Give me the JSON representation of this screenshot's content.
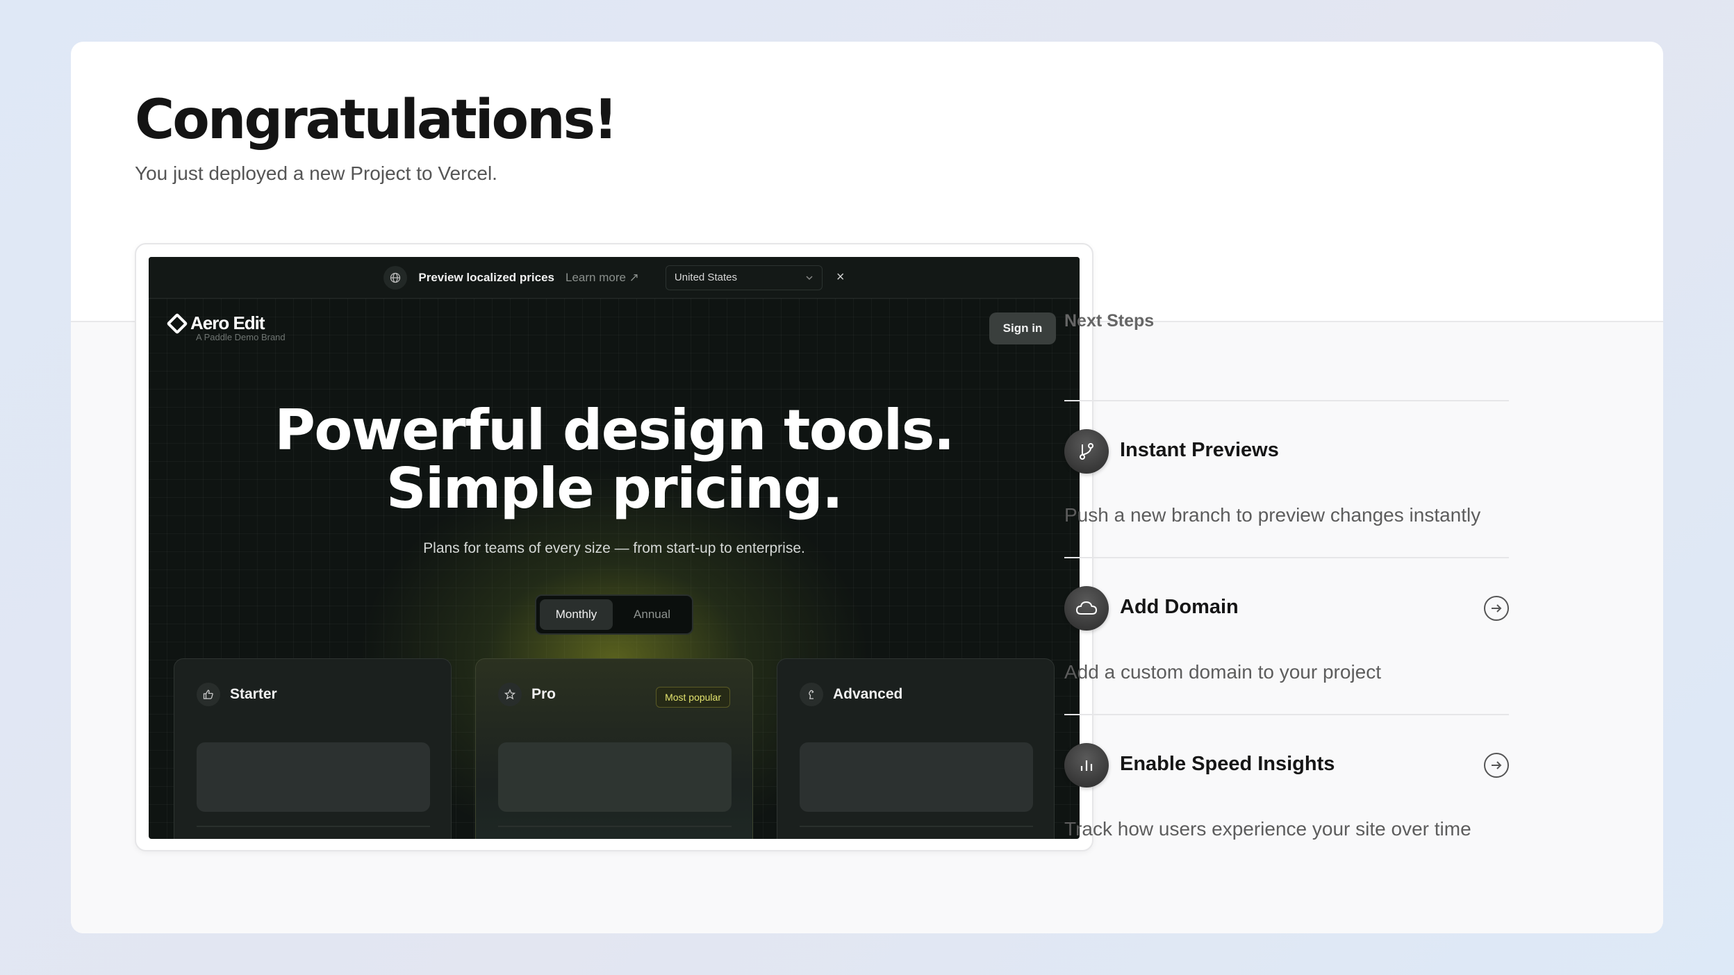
{
  "header": {
    "title": "Congratulations!",
    "subtitle": "You just deployed a new Project to Vercel."
  },
  "preview": {
    "announcement": {
      "text": "Preview localized prices",
      "learn_more": "Learn more ↗",
      "country": "United States",
      "close": "×"
    },
    "brand": {
      "name": "Aero Edit",
      "tagline": "A Paddle Demo Brand"
    },
    "sign_in": "Sign in",
    "hero_line1": "Powerful design tools.",
    "hero_line2": "Simple pricing.",
    "hero_sub": "Plans for teams of every size — from start-up to enterprise.",
    "billing_toggle": {
      "monthly": "Monthly",
      "annual": "Annual"
    },
    "plans": [
      {
        "name": "Starter"
      },
      {
        "name": "Pro",
        "badge": "Most popular"
      },
      {
        "name": "Advanced"
      }
    ]
  },
  "next_steps": {
    "title": "Next Steps",
    "items": [
      {
        "title": "Instant Previews",
        "description": "Push a new branch to preview changes instantly",
        "icon": "git-branch-icon"
      },
      {
        "title": "Add Domain",
        "description": "Add a custom domain to your project",
        "icon": "cloud-icon"
      },
      {
        "title": "Enable Speed Insights",
        "description": "Track how users experience your site over time",
        "icon": "bar-chart-icon"
      }
    ]
  }
}
